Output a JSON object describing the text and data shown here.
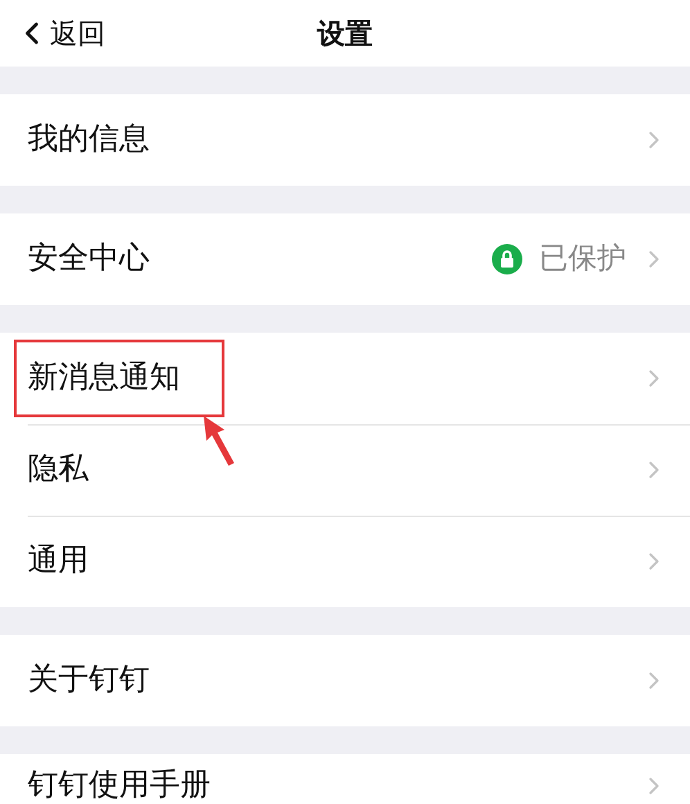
{
  "header": {
    "back_label": "返回",
    "title": "设置"
  },
  "sections": [
    [
      {
        "label": "我的信息",
        "highlighted": false
      }
    ],
    [
      {
        "label": "安全中心",
        "value": "已保护",
        "highlighted": false
      }
    ],
    [
      {
        "label": "新消息通知",
        "highlighted": true
      },
      {
        "label": "隐私",
        "highlighted": false
      },
      {
        "label": "通用",
        "highlighted": false
      }
    ],
    [
      {
        "label": "关于钉钉",
        "highlighted": false
      }
    ],
    [
      {
        "label": "钉钉使用手册",
        "highlighted": false
      }
    ]
  ]
}
